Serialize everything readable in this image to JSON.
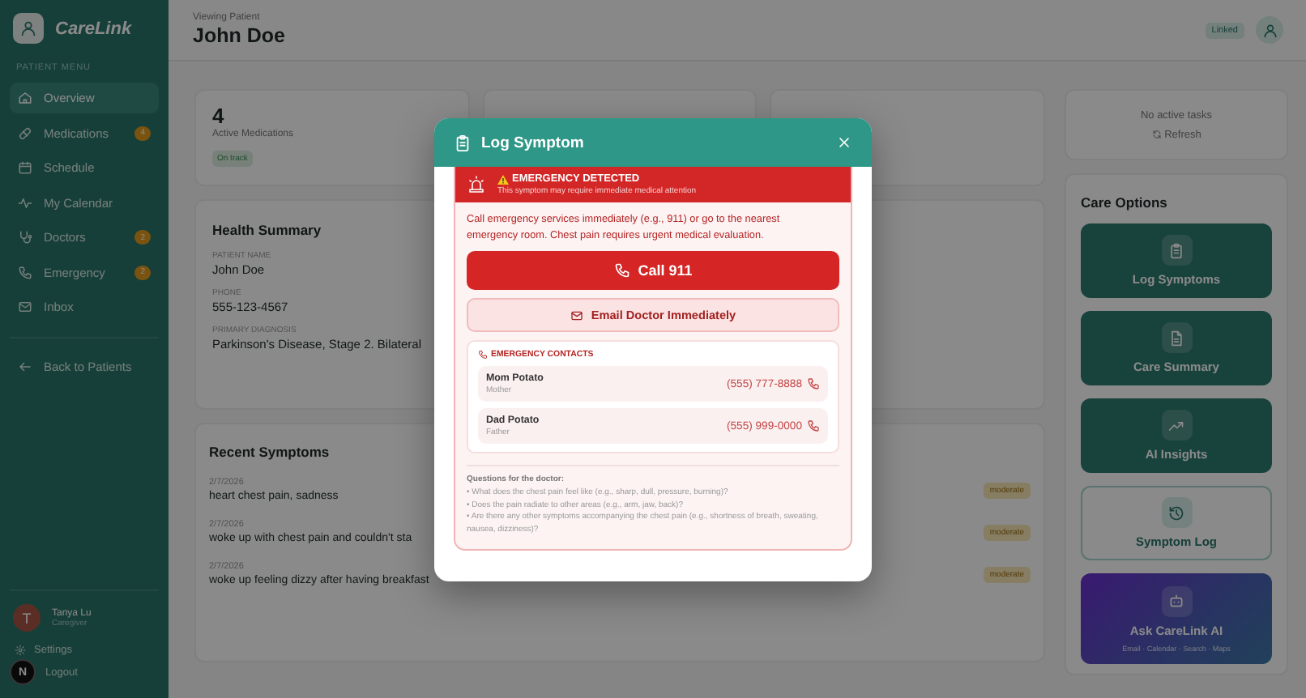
{
  "sidebar": {
    "logo_text": "CareLink",
    "section_label": "PATIENT MENU",
    "items": [
      {
        "label": "Overview",
        "selected": true
      },
      {
        "label": "Medications",
        "badge": "4",
        "selected": false
      },
      {
        "label": "Schedule",
        "selected": false
      },
      {
        "label": "My Calendar",
        "selected": false
      },
      {
        "label": "Doctors",
        "badge": "2",
        "selected": false
      },
      {
        "label": "Emergency",
        "badge": "2",
        "selected": false
      },
      {
        "label": "Inbox",
        "selected": false
      }
    ],
    "back_link": "Back to Patients",
    "user": {
      "initial": "T",
      "name": "Tanya Lu",
      "role": "Caregiver"
    },
    "settings": "Settings",
    "logout": "Logout",
    "dev_badge": "N"
  },
  "header": {
    "viewing_label": "Viewing Patient",
    "patient_name": "John Doe",
    "linked_badge": "Linked"
  },
  "stats": [
    {
      "value": "4",
      "label": "Active Medications",
      "badge": "On track"
    }
  ],
  "health_summary": {
    "title": "Health Summary",
    "fields": [
      {
        "label": "PATIENT NAME",
        "value": "John Doe"
      },
      {
        "label": "PHONE",
        "value": "555-123-4567"
      },
      {
        "label": "PRIMARY DIAGNOSIS",
        "value": "Parkinson's Disease, Stage 2. Bilateral"
      }
    ]
  },
  "recent_symptoms": {
    "title": "Recent Symptoms",
    "items": [
      {
        "date": "2/7/2026",
        "text": "heart chest pain, sadness",
        "severity": "moderate"
      },
      {
        "date": "2/7/2026",
        "text": "woke up with chest pain and couldn't sta",
        "severity": "moderate"
      },
      {
        "date": "2/7/2026",
        "text": "woke up feeling dizzy after having breakfast",
        "severity": "moderate"
      }
    ]
  },
  "tasks": {
    "empty_text": "No active tasks",
    "refresh": "Refresh"
  },
  "care_options": {
    "title": "Care Options",
    "items": [
      {
        "label": "Log Symptoms",
        "kind": "filled"
      },
      {
        "label": "Care Summary",
        "kind": "filled"
      },
      {
        "label": "AI Insights",
        "kind": "filled"
      },
      {
        "label": "Symptom Log",
        "kind": "outline"
      },
      {
        "label": "Ask CareLink AI",
        "kind": "ai",
        "subtitle": "Email · Calendar · Search · Maps"
      }
    ]
  },
  "modal": {
    "title": "Log Symptom",
    "alert": {
      "title": "EMERGENCY DETECTED",
      "subtitle": "This symptom may require immediate medical attention"
    },
    "message": "Call emergency services immediately (e.g., 911) or go to the nearest emergency room. Chest pain requires urgent medical evaluation.",
    "call_button": "Call 911",
    "email_button": "Email Doctor Immediately",
    "contacts": {
      "title": "EMERGENCY CONTACTS",
      "items": [
        {
          "name": "Mom Potato",
          "relation": "Mother",
          "phone": "(555) 777-8888"
        },
        {
          "name": "Dad Potato",
          "relation": "Father",
          "phone": "(555) 999-0000"
        }
      ]
    },
    "questions": {
      "title": "Questions for the doctor:",
      "items": [
        "• What does the chest pain feel like (e.g., sharp, dull, pressure, burning)?",
        "• Does the pain radiate to other areas (e.g., arm, jaw, back)?",
        "• Are there any other symptoms accompanying the chest pain (e.g., shortness of breath, sweating, nausea, dizziness)?"
      ]
    }
  }
}
